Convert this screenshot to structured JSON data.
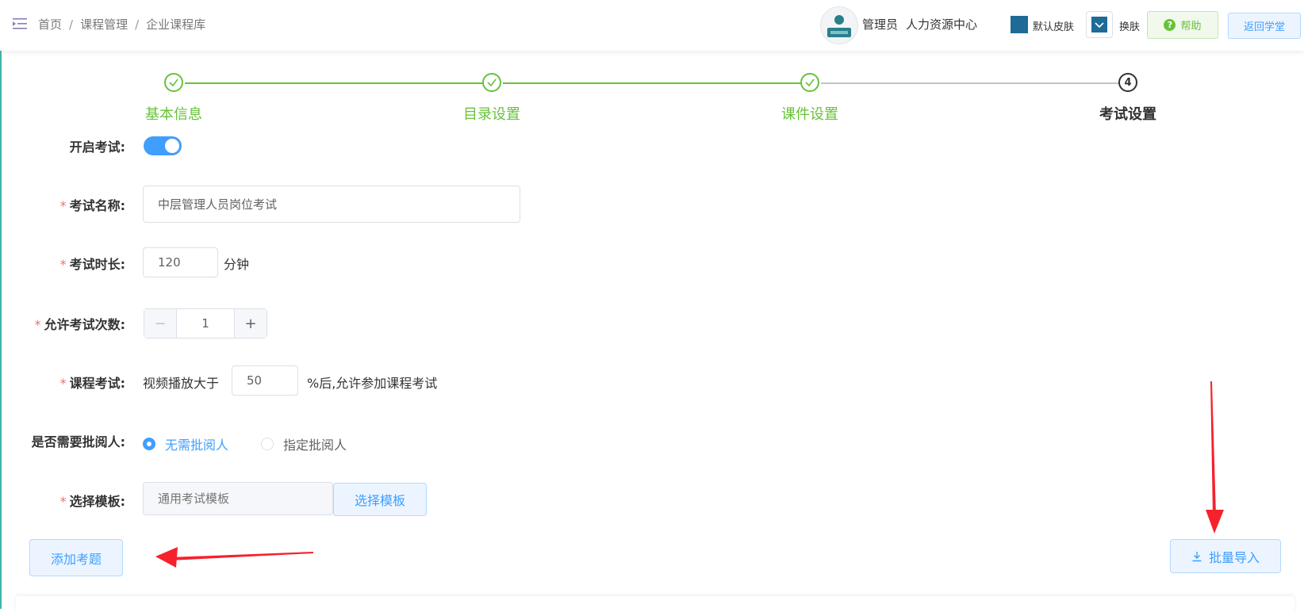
{
  "header": {
    "breadcrumb": [
      "首页",
      "课程管理",
      "企业课程库"
    ],
    "user_role": "管理员",
    "department": "人力资源中心",
    "skin_label": "默认皮肤",
    "skin_color": "#1e6b98",
    "change_skin": "换肤",
    "help": "帮助",
    "return": "返回学堂"
  },
  "steps": [
    {
      "label": "基本信息",
      "status": "done"
    },
    {
      "label": "目录设置",
      "status": "done"
    },
    {
      "label": "课件设置",
      "status": "done"
    },
    {
      "label": "考试设置",
      "status": "active",
      "number": "4"
    }
  ],
  "form": {
    "enable_exam": {
      "label": "开启考试:",
      "value": true
    },
    "exam_name": {
      "label": "考试名称:",
      "value": "中层管理人员岗位考试",
      "required": true
    },
    "exam_duration": {
      "label": "考试时长:",
      "value": "120",
      "unit": "分钟",
      "required": true
    },
    "attempts": {
      "label": "允许考试次数:",
      "value": "1",
      "required": true
    },
    "course_exam": {
      "label": "课程考试:",
      "prefix": "视频播放大于",
      "value": "50",
      "suffix": "%后,允许参加课程考试",
      "required": true
    },
    "reviewer": {
      "label": "是否需要批阅人:",
      "options": [
        "无需批阅人",
        "指定批阅人"
      ],
      "selected": "无需批阅人"
    },
    "template": {
      "label": "选择模板:",
      "placeholder": "通用考试模板",
      "button": "选择模板",
      "required": true
    }
  },
  "actions": {
    "add_question": "添加考题",
    "batch_import": "批量导入"
  },
  "colors": {
    "primary": "#409eff",
    "success": "#67c23a",
    "arrow": "#f5222d"
  }
}
